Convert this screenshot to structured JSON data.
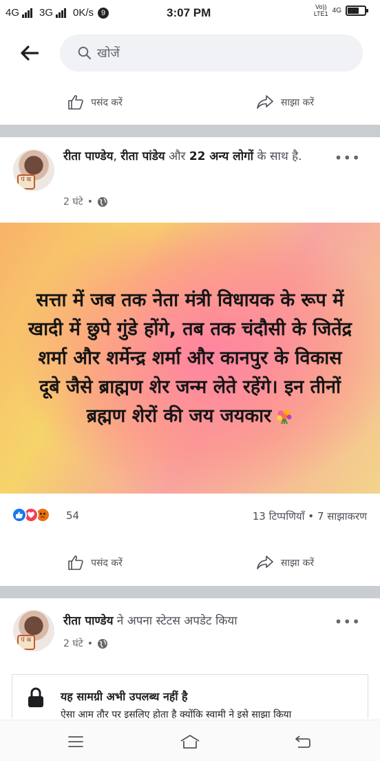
{
  "status_bar": {
    "network1": "4G",
    "network2": "3G",
    "speed": "0K/s",
    "notif_count": "9",
    "time": "3:07 PM",
    "volte": "Vo))",
    "lte": "LTE1",
    "net4g": "4G",
    "battery_level": 0.62
  },
  "header": {
    "search_placeholder": "खोजें"
  },
  "top_actions": {
    "like_label": "पसंद करें",
    "share_label": "साझा करें"
  },
  "post1": {
    "author1": "रीता पाण्डेय",
    "author2": "रीता पांडेय",
    "joiner": " और ",
    "others": "22 अन्य लोगों",
    "suffix": " के साथ है.",
    "time": "2 घंटे",
    "dot": "•",
    "more": "•••",
    "image_text": "सत्ता में जब तक नेता मंत्री विधायक के रूप में खादी में छुपे गुंडे होंगे, तब तक चंदौसी के जितेंद्र शर्मा और शर्मेन्द्र शर्मा और कानपुर के विकास दूबे जैसे ब्राह्मण शेर जन्म लेते रहेंगे। इन तीनों ब्रह्मण शेरों की जय जयकार",
    "reaction_count": "54",
    "comments": "13 टिप्पणियाँ",
    "shares": "7 साझाकरण",
    "like_label": "पसंद करें",
    "share_label": "साझा करें"
  },
  "post2": {
    "author": "रीता पाण्डेय",
    "action": " ने अपना स्टेटस अपडेट किया",
    "time": "2 घंटे",
    "dot": "•",
    "more": "•••",
    "unavailable_title": "यह सामग्री अभी उपलब्ध नहीं है",
    "unavailable_sub": "ऐसा आम तौर पर इसलिए होता है क्योंकि स्वामी ने इसे साझा किया"
  },
  "avatar_stamp": "पं क",
  "colors": {
    "like_blue": "#1877f2",
    "love_red": "#f33e58",
    "angry_orange": "#e9710f",
    "separator": "#c9ccd1"
  }
}
